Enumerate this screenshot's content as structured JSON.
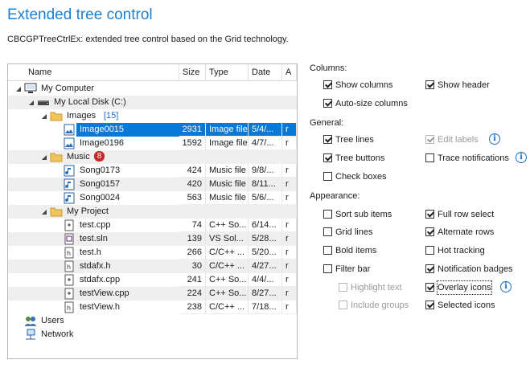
{
  "page": {
    "title": "Extended tree control",
    "subtitle": "CBCGPTreeCtrlEx: extended tree control based on the Grid technology."
  },
  "tree": {
    "columns": [
      "Name",
      "Size",
      "Type",
      "Date",
      "A"
    ],
    "rows": [
      {
        "label": "My Computer",
        "icon": "computer-icon",
        "expander": "expanded"
      },
      {
        "label": "My Local Disk (C:)",
        "icon": "disk-icon",
        "expander": "expanded"
      },
      {
        "label": "Images",
        "count": "[15]",
        "icon": "folder-icon",
        "expander": "expanded"
      },
      {
        "label": "Image0015",
        "size": "2931",
        "type": "Image file",
        "date": "5/4/...",
        "attr": "r",
        "icon": "image-file-icon",
        "selected": true
      },
      {
        "label": "Image0196",
        "size": "1592",
        "type": "Image file",
        "date": "4/7/...",
        "attr": "r",
        "icon": "image-file-icon"
      },
      {
        "label": "Music",
        "badge": "8",
        "icon": "folder-icon",
        "expander": "expanded"
      },
      {
        "label": "Song0173",
        "size": "424",
        "type": "Music file",
        "date": "9/8/...",
        "attr": "r",
        "icon": "music-file-icon"
      },
      {
        "label": "Song0157",
        "size": "420",
        "type": "Music file",
        "date": "8/11...",
        "attr": "r",
        "icon": "music-file-icon"
      },
      {
        "label": "Song0024",
        "size": "563",
        "type": "Music file",
        "date": "5/6/...",
        "attr": "r",
        "icon": "music-file-icon"
      },
      {
        "label": "My Project",
        "icon": "folder-icon",
        "expander": "expanded"
      },
      {
        "label": "test.cpp",
        "size": "74",
        "type": "C++ So...",
        "date": "6/14...",
        "attr": "r",
        "icon": "cpp-file-icon"
      },
      {
        "label": "test.sln",
        "size": "139",
        "type": "VS Sol...",
        "date": "5/28...",
        "attr": "r",
        "icon": "sln-file-icon"
      },
      {
        "label": "test.h",
        "size": "266",
        "type": "C/C++ ...",
        "date": "5/20...",
        "attr": "r",
        "icon": "header-file-icon"
      },
      {
        "label": "stdafx.h",
        "size": "30",
        "type": "C/C++ ...",
        "date": "4/27...",
        "attr": "r",
        "icon": "header-file-icon"
      },
      {
        "label": "stdafx.cpp",
        "size": "241",
        "type": "C++ So...",
        "date": "4/4/...",
        "attr": "r",
        "icon": "cpp-file-icon"
      },
      {
        "label": "testView.cpp",
        "size": "224",
        "type": "C++ So...",
        "date": "8/27...",
        "attr": "r",
        "icon": "cpp-file-icon"
      },
      {
        "label": "testView.h",
        "size": "238",
        "type": "C/C++ ...",
        "date": "7/18...",
        "attr": "r",
        "icon": "header-file-icon"
      },
      {
        "label": "Users",
        "icon": "users-icon"
      },
      {
        "label": "Network",
        "icon": "network-icon"
      }
    ]
  },
  "options": {
    "columns": {
      "heading": "Columns:",
      "show_columns": {
        "label": "Show columns",
        "checked": true
      },
      "show_header": {
        "label": "Show header",
        "checked": true
      },
      "auto_size": {
        "label": "Auto-size columns",
        "checked": true
      }
    },
    "general": {
      "heading": "General:",
      "tree_lines": {
        "label": "Tree lines",
        "checked": true
      },
      "edit_labels": {
        "label": "Edit labels",
        "checked": true,
        "disabled": true
      },
      "tree_buttons": {
        "label": "Tree buttons",
        "checked": true
      },
      "trace_notifications": {
        "label": "Trace notifications",
        "checked": false
      },
      "check_boxes": {
        "label": "Check boxes",
        "checked": false
      }
    },
    "appearance": {
      "heading": "Appearance:",
      "sort_sub_items": {
        "label": "Sort sub items",
        "checked": false
      },
      "full_row_select": {
        "label": "Full row select",
        "checked": true
      },
      "grid_lines": {
        "label": "Grid lines",
        "checked": false
      },
      "alternate_rows": {
        "label": "Alternate rows",
        "checked": true
      },
      "bold_items": {
        "label": "Bold items",
        "checked": false
      },
      "hot_tracking": {
        "label": "Hot tracking",
        "checked": false
      },
      "filter_bar": {
        "label": "Filter bar",
        "checked": false
      },
      "notification_badges": {
        "label": "Notification badges",
        "checked": true
      },
      "highlight_text": {
        "label": "Highlight text",
        "checked": false,
        "disabled": true
      },
      "overlay_icons": {
        "label": "Overlay icons",
        "checked": true
      },
      "include_groups": {
        "label": "Include groups",
        "checked": false,
        "disabled": true
      },
      "selected_icons": {
        "label": "Selected icons",
        "checked": true
      }
    },
    "info_glyph": "i"
  },
  "colors": {
    "accent": "#1f7fce",
    "selection": "#0a78d7",
    "badge": "#c62828"
  }
}
